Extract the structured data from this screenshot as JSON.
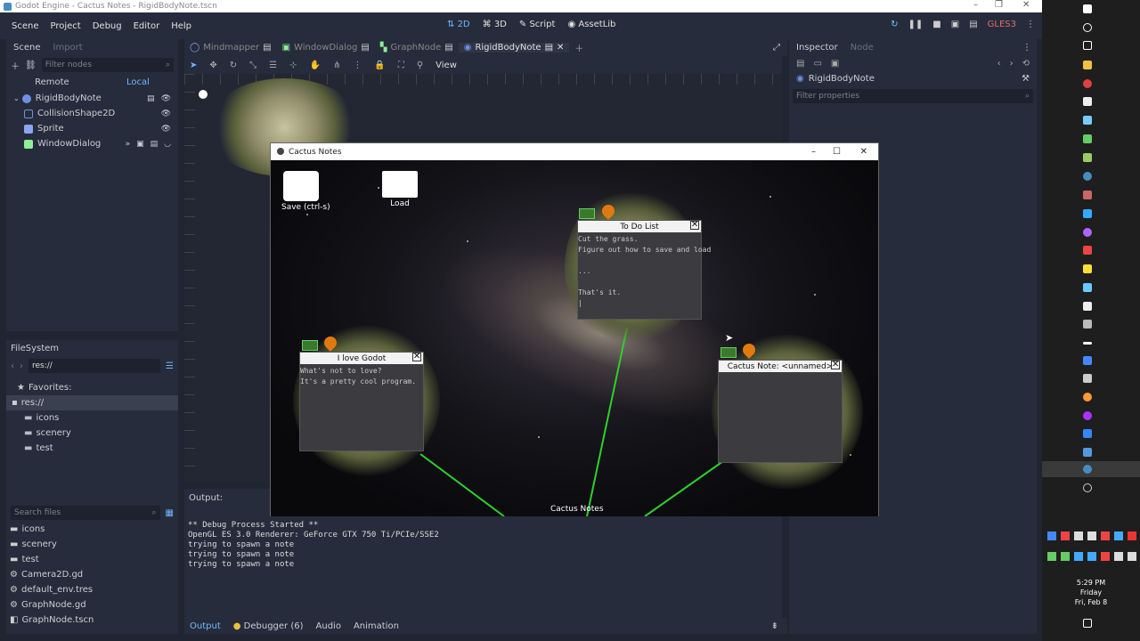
{
  "window": {
    "title": "Godot Engine - Cactus Notes - RigidBodyNote.tscn"
  },
  "menu": [
    "Scene",
    "Project",
    "Debug",
    "Editor",
    "Help"
  ],
  "modes": [
    {
      "label": "2D",
      "active": true
    },
    {
      "label": "3D"
    },
    {
      "label": "Script"
    },
    {
      "label": "AssetLib"
    }
  ],
  "renderer": "GLES3",
  "scene_panel": {
    "tabs": [
      "Scene",
      "Import"
    ],
    "filter_placeholder": "Filter nodes",
    "remote": "Remote",
    "local": "Local",
    "nodes": [
      {
        "label": "RigidBodyNote",
        "color": "#6d90e6",
        "depth": 0
      },
      {
        "label": "CollisionShape2D",
        "color": "#6d90e6",
        "depth": 1
      },
      {
        "label": "Sprite",
        "color": "#8da5f3",
        "depth": 1
      },
      {
        "label": "WindowDialog",
        "color": "#8eef97",
        "depth": 1
      }
    ]
  },
  "filesystem": {
    "title": "FileSystem",
    "path": "res://",
    "favorites": "Favorites:",
    "tree": [
      "res://",
      "icons",
      "scenery",
      "test"
    ],
    "search_placeholder": "Search files",
    "files": [
      "icons",
      "scenery",
      "test",
      "Camera2D.gd",
      "default_env.tres",
      "GraphNode.gd",
      "GraphNode.tscn"
    ]
  },
  "editor_tabs": [
    {
      "label": "Mindmapper",
      "active": false
    },
    {
      "label": "WindowDialog",
      "active": false
    },
    {
      "label": "GraphNode",
      "active": false
    },
    {
      "label": "RigidBodyNote",
      "active": true
    }
  ],
  "viewport_toolbar": {
    "view": "View"
  },
  "game": {
    "title": "Cactus Notes",
    "save_label": "Save (ctrl-s)",
    "load_label": "Load",
    "footer": "Cactus Notes",
    "notes": [
      {
        "title": "To Do List",
        "body": "Cut the grass.\nFigure out how to save and load\n\n...\n\nThat's it.\n|"
      },
      {
        "title": "I love Godot",
        "body": "What's not to love?\nIt's a pretty cool program."
      },
      {
        "title": "Cactus Note: <unnamed>",
        "body": ""
      }
    ]
  },
  "output": {
    "title": "Output:",
    "lines": "** Debug Process Started **\nOpenGL ES 3.0 Renderer: GeForce GTX 750 Ti/PCIe/SSE2\ntrying to spawn a note\ntrying to spawn a note\ntrying to spawn a note"
  },
  "bottom_tabs": [
    "Output",
    "Debugger (6)",
    "Audio",
    "Animation"
  ],
  "inspector": {
    "tabs": [
      "Inspector",
      "Node"
    ],
    "node": "RigidBodyNote",
    "filter_placeholder": "Filter properties"
  },
  "clock": {
    "time": "5:29 PM",
    "day": "Friday",
    "date": "Fri, Feb 8"
  }
}
